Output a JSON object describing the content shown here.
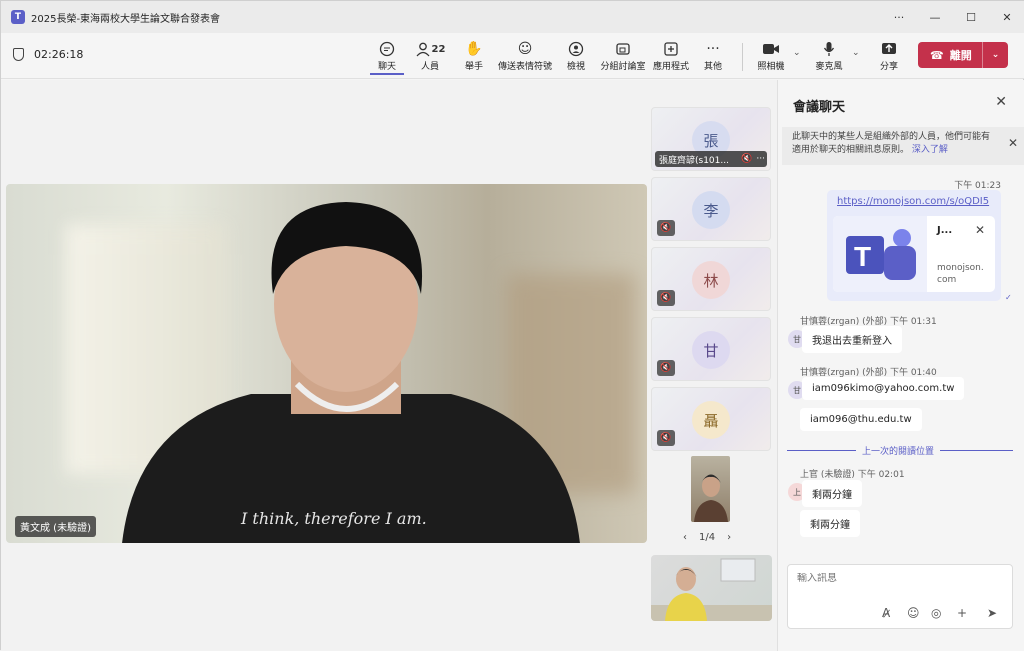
{
  "window": {
    "title": "2025長榮-東海兩校大學生論文聯合發表會",
    "ctrl_more": "···",
    "ctrl_min": "—",
    "ctrl_max": "☐",
    "ctrl_close": "✕"
  },
  "meeting": {
    "timer": "02:26:18"
  },
  "toolbar": {
    "chat": "聊天",
    "people": "人員",
    "people_count": "22",
    "raise": "舉手",
    "react": "傳送表情符號",
    "view": "檢視",
    "rooms": "分組討論室",
    "apps": "應用程式",
    "more": "其他",
    "camera": "照相機",
    "mic": "麥克風",
    "share": "分享",
    "leave": "離開"
  },
  "stage": {
    "main_name": "黃文成 (未驗證)",
    "tiles": [
      {
        "initial": "張",
        "name": "張庭齊諺(s101...",
        "color": "#d7dcf0"
      },
      {
        "initial": "李",
        "name": "",
        "color": "#d4dbf0"
      },
      {
        "initial": "林",
        "name": "",
        "color": "#f0d7d7"
      },
      {
        "initial": "甘",
        "name": "",
        "color": "#ddd9f0"
      },
      {
        "initial": "聶",
        "name": "",
        "color": "#f5e8cc"
      }
    ],
    "pager": "1/4"
  },
  "chat": {
    "title": "會議聊天",
    "notice": "此聊天中的某些人是組織外部的人員，他們可能有適用於聊天的相關訊息原則。",
    "notice_link": "深入了解",
    "msg1_time": "下午 01:23",
    "link_url": "https://monojson.com/s/oQDI5",
    "card_title": "J...",
    "card_domain": "monojson.\ncom",
    "m2_meta": "甘慎蓉(zrgan) (外部)  下午 01:31",
    "m2_avatar": "甘",
    "m2_text": "我退出去重新登入",
    "m3_meta": "甘慎蓉(zrgan) (外部)  下午 01:40",
    "m3_avatar": "甘",
    "m3_text1": "iam096kimo@yahoo.com.tw",
    "m3_text2": "iam096@thu.edu.tw",
    "last_read": "上一次的閱讀位置",
    "m4_meta": "上官 (未驗證)  下午 02:01",
    "m4_avatar": "上",
    "m4_text1": "剩兩分鐘",
    "m4_text2": "剩兩分鐘",
    "compose_placeholder": "輸入訊息"
  }
}
